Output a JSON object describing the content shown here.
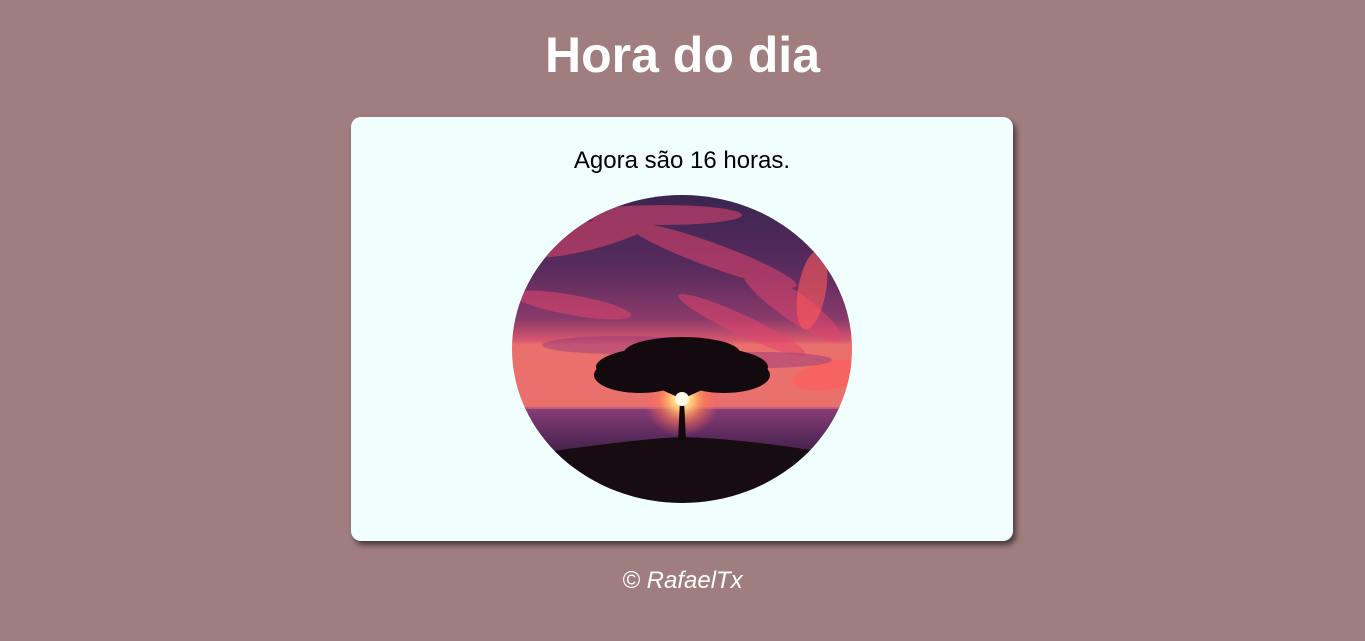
{
  "header": {
    "title": "Hora do dia"
  },
  "card": {
    "message": "Agora são 16 horas.",
    "image": {
      "subject": "sunset-tree-photo",
      "shape": "ellipse"
    }
  },
  "footer": {
    "copyright": "© RafaelTx"
  },
  "colors": {
    "page_background": "#a07e80",
    "card_background": "#f0fffe",
    "title_text": "#ffffff",
    "message_text": "#000000"
  }
}
